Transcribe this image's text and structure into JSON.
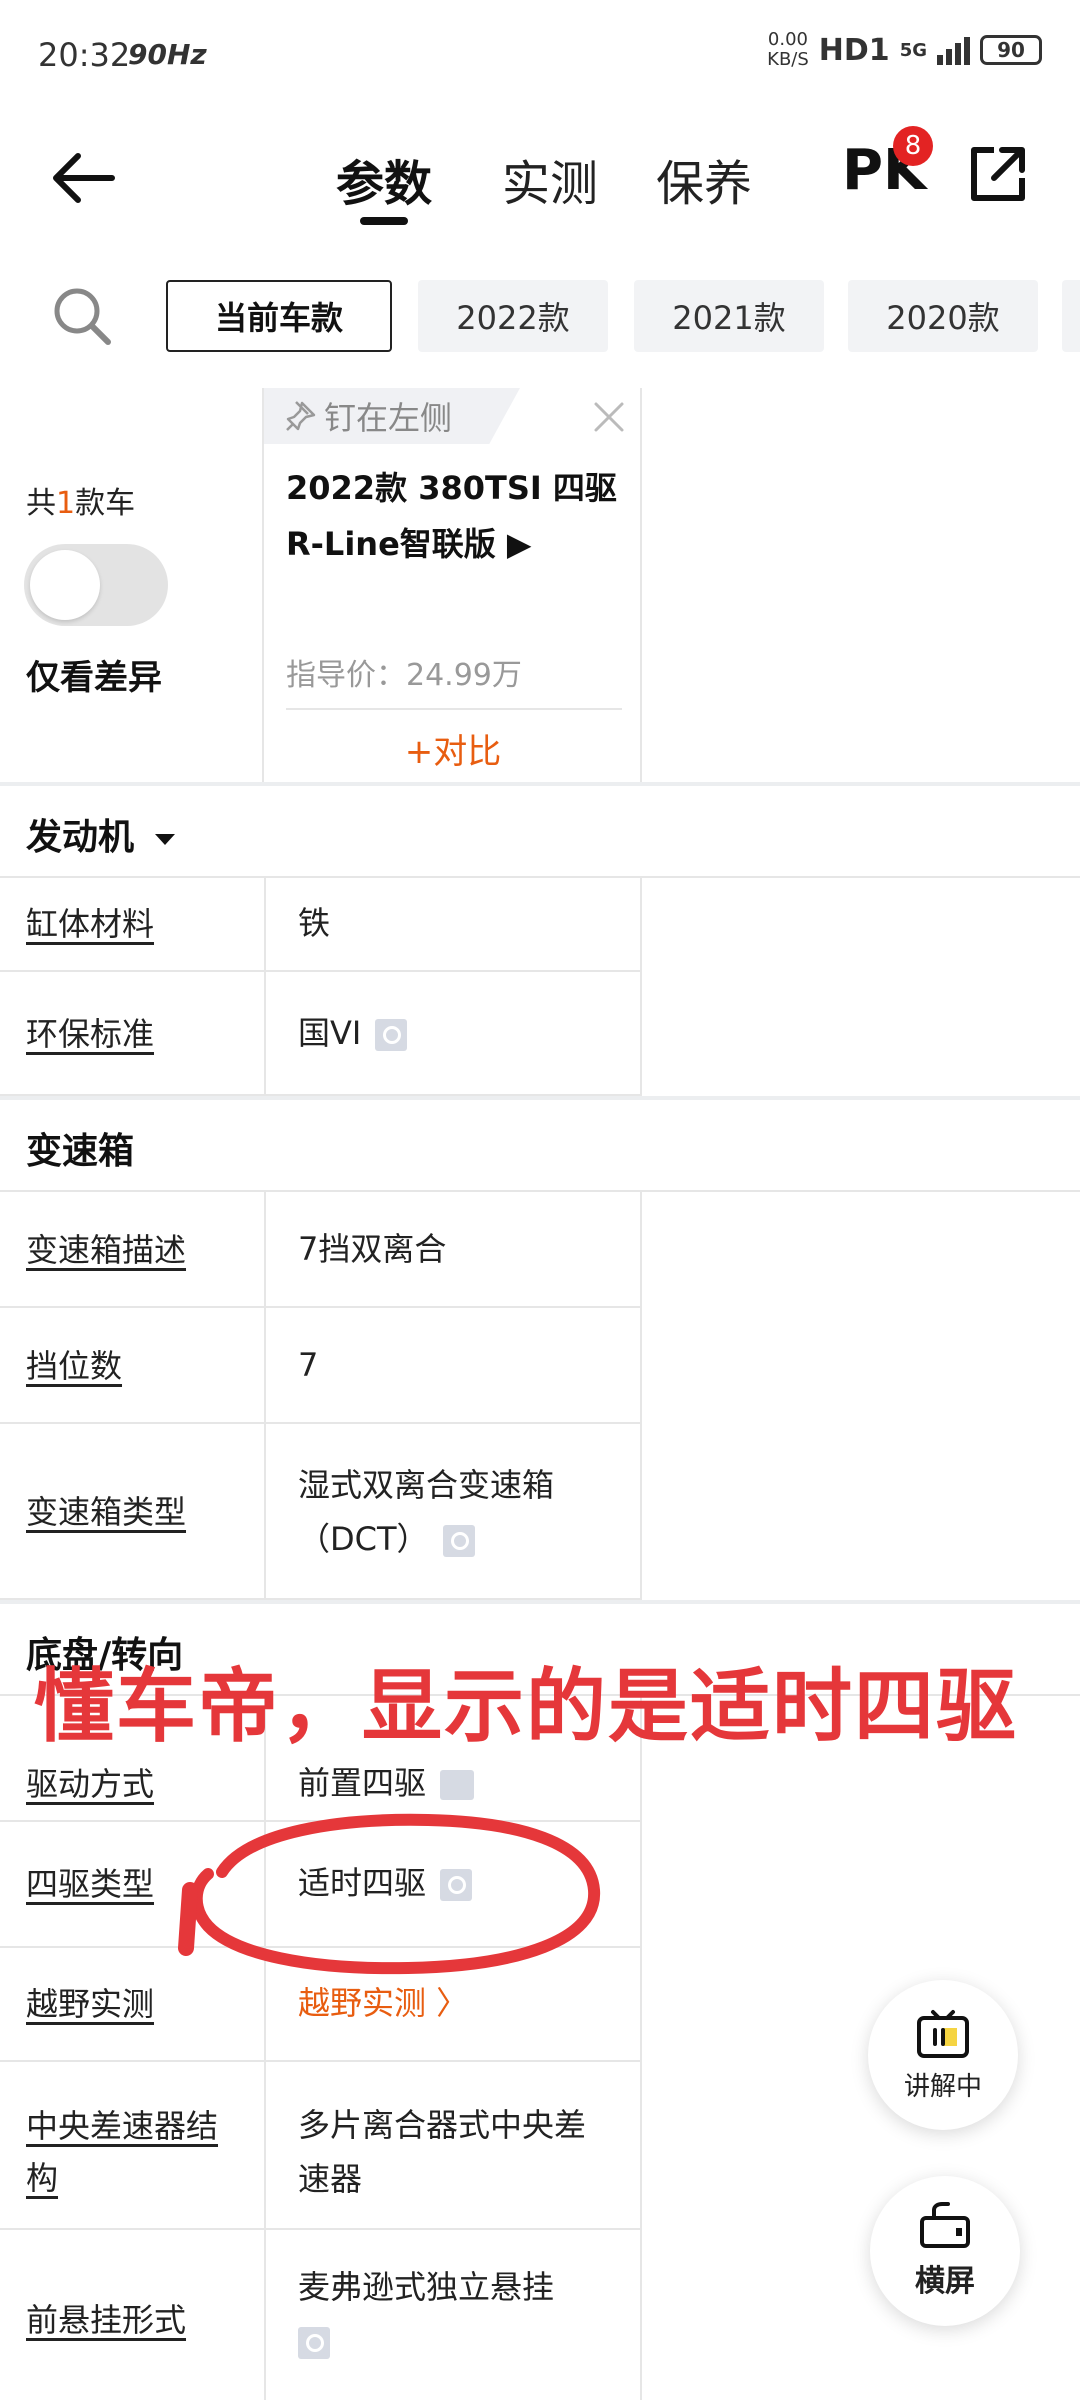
{
  "status_bar": {
    "time": "20:32",
    "refresh": "90Hz",
    "net_speed": "0.00",
    "net_unit": "KB/S",
    "hd": "HD1",
    "network": "5G",
    "battery": "90"
  },
  "nav": {
    "tabs": [
      "参数",
      "实测",
      "保养"
    ],
    "active_tab": "参数",
    "pk_label": "PK",
    "pk_badge": "8"
  },
  "filters": [
    "当前车款",
    "2022款",
    "2021款",
    "2020款"
  ],
  "car_header": {
    "count_prefix": "共",
    "count_num": "1",
    "count_suffix": "款车",
    "only_diff": "仅看差异",
    "pin_label": "钉在左侧",
    "car_name_line1": "2022款 380TSI 四驱",
    "car_name_line2": "R-Line智联版 ▶",
    "price": "指导价：24.99万",
    "compare": "+对比"
  },
  "sections": {
    "engine": "发动机",
    "gearbox": "变速箱",
    "chassis": "底盘/转向"
  },
  "rows": {
    "block_material": {
      "label": "缸体材料",
      "value": "铁"
    },
    "emission": {
      "label": "环保标准",
      "value": "国VI"
    },
    "gearbox_desc": {
      "label": "变速箱描述",
      "value": "7挡双离合"
    },
    "gears": {
      "label": "挡位数",
      "value": "7"
    },
    "gearbox_type": {
      "label": "变速箱类型",
      "value1": "湿式双离合变速箱",
      "value2": "（DCT）"
    },
    "drive": {
      "label": "驱动方式",
      "value": "前置四驱"
    },
    "awd_type": {
      "label": "四驱类型",
      "value": "适时四驱"
    },
    "offroad": {
      "label": "越野实测",
      "value": "越野实测 〉"
    },
    "center_diff": {
      "label1": "中央差速器结",
      "label2": "构",
      "value1": "多片离合器式中央差",
      "value2": "速器"
    },
    "front_susp": {
      "label": "前悬挂形式",
      "value": "麦弗逊式独立悬挂"
    }
  },
  "annotation": "懂车帝，显示的是适时四驱",
  "fab": {
    "explain": "讲解中",
    "landscape": "横屏"
  },
  "colors": {
    "accent": "#e85d10",
    "badge": "#e32323",
    "annotation": "#e5373a"
  }
}
